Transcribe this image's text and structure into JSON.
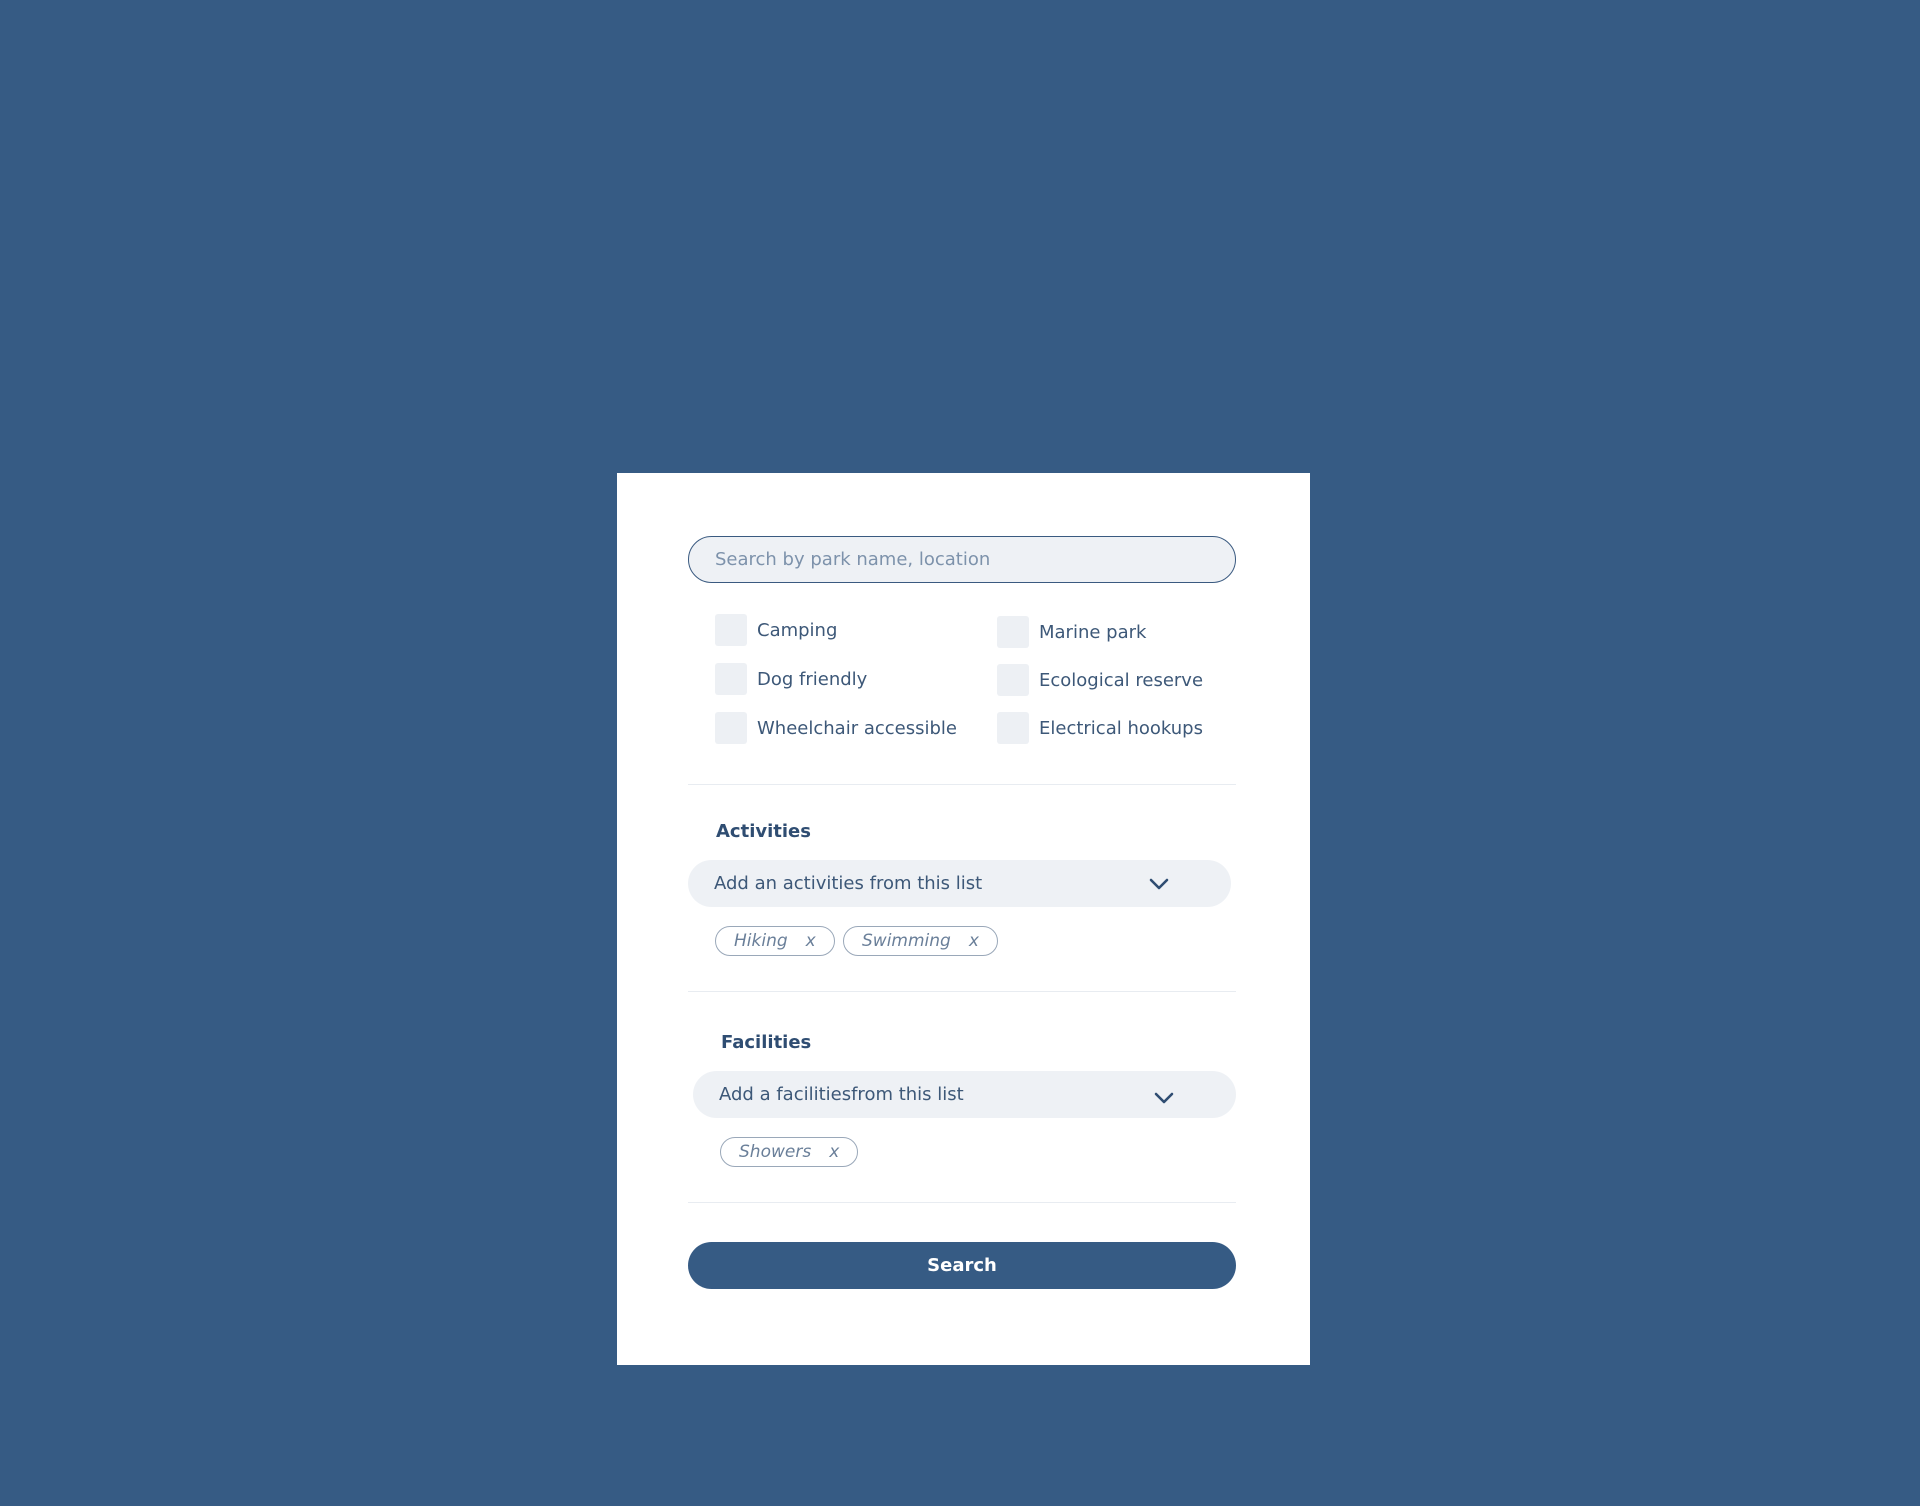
{
  "search": {
    "placeholder": "Search by park name, location"
  },
  "filters": {
    "left": [
      {
        "label": "Camping"
      },
      {
        "label": "Dog friendly"
      },
      {
        "label": "Wheelchair accessible"
      }
    ],
    "right": [
      {
        "label": "Marine park"
      },
      {
        "label": "Ecological reserve"
      },
      {
        "label": "Electrical hookups"
      }
    ]
  },
  "activities": {
    "title": "Activities",
    "dropdown_label": "Add an activities from this list",
    "icon": "chevron-down-icon",
    "tags": [
      {
        "label": "Hiking",
        "remove": "x"
      },
      {
        "label": "Swimming",
        "remove": "x"
      }
    ]
  },
  "facilities": {
    "title": "Facilities",
    "dropdown_label": "Add a facilitiesfrom this list",
    "icon": "chevron-down-icon",
    "tags": [
      {
        "label": "Showers",
        "remove": "x"
      }
    ]
  },
  "actions": {
    "search_label": "Search"
  },
  "colors": {
    "background": "#365b84",
    "card": "#ffffff",
    "field": "#eef1f5",
    "primary": "#365b84"
  }
}
